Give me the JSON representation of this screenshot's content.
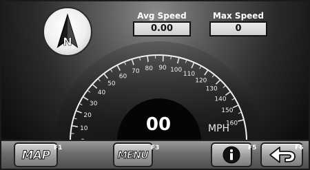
{
  "compass": {
    "heading_letter": "N"
  },
  "avg_speed": {
    "label": "Avg Speed",
    "value": "0.00"
  },
  "max_speed": {
    "label": "Max Speed",
    "value": "0"
  },
  "speedometer": {
    "current_speed": "00",
    "unit": "MPH",
    "ticks": [
      "0",
      "10",
      "20",
      "30",
      "40",
      "50",
      "60",
      "70",
      "80",
      "90",
      "100",
      "110",
      "120",
      "130",
      "140",
      "150",
      "160"
    ]
  },
  "buttons": {
    "map": {
      "label": "MAP",
      "fkey": "F1"
    },
    "menu": {
      "label": "MENU",
      "fkey": "F3"
    },
    "info": {
      "fkey": "F5"
    },
    "back": {
      "fkey": "F6"
    }
  }
}
